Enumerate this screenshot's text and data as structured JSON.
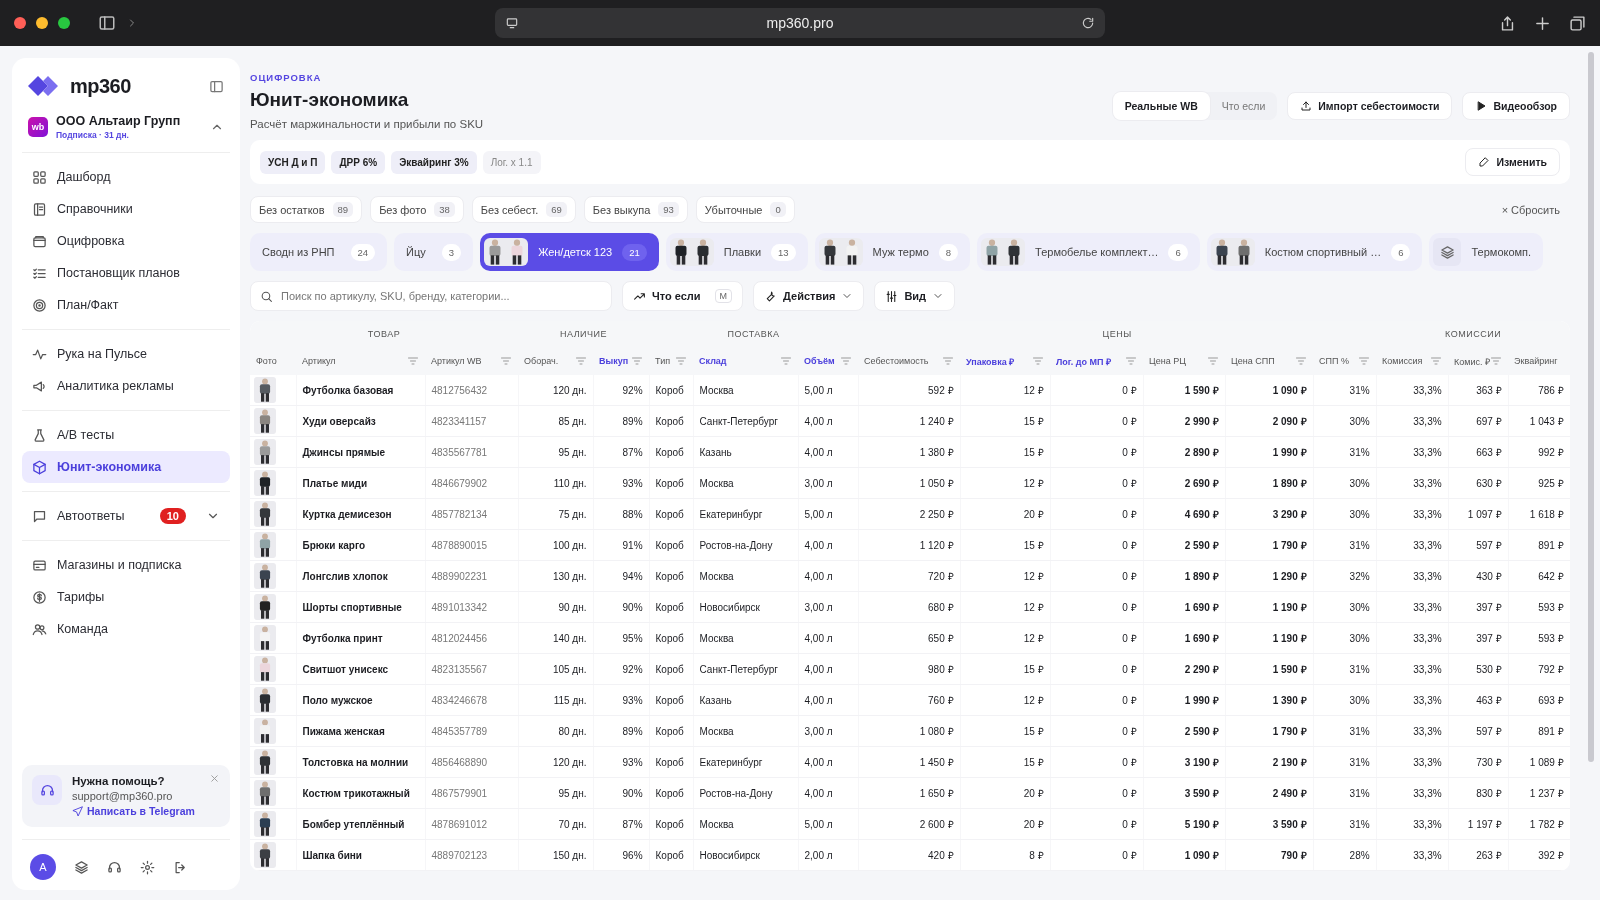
{
  "browser": {
    "url": "mp360.pro"
  },
  "sidebar": {
    "logo": "mp360",
    "account": {
      "badge": "wb",
      "name": "ООО Альтаир Групп",
      "subscription": "Подписка · 31 дн.",
      "expanded": true
    },
    "groups": [
      [
        {
          "label": "Дашборд",
          "selected": false
        },
        {
          "label": "Справочники",
          "selected": false
        },
        {
          "label": "Оцифровка",
          "selected": false
        },
        {
          "label": "Постановщик планов",
          "selected": false
        },
        {
          "label": "План/Факт",
          "selected": false
        }
      ],
      [
        {
          "label": "Рука на Пульсе",
          "selected": false
        },
        {
          "label": "Аналитика рекламы",
          "selected": false
        }
      ],
      [
        {
          "label": "A/B тесты",
          "selected": false
        },
        {
          "label": "Юнит-экономика",
          "selected": true
        }
      ],
      [
        {
          "label": "Автоответы",
          "selected": false,
          "badge": "10",
          "expanded": false
        }
      ],
      [
        {
          "label": "Магазины и подписка",
          "selected": false
        },
        {
          "label": "Тарифы",
          "selected": false
        },
        {
          "label": "Команда",
          "selected": false
        }
      ]
    ],
    "help": {
      "title": "Нужна помощь?",
      "email": "support@mp360.pro",
      "link": "Написать в Telegram"
    },
    "avatar": "A"
  },
  "header": {
    "breadcrumb": "ОЦИФРОВКА",
    "title": "Юнит-экономика",
    "subtitle": "Расчёт маржинальности и прибыли по SKU",
    "modes": [
      {
        "label": "Реальные WB",
        "selected": true
      },
      {
        "label": "Что если",
        "selected": false
      }
    ],
    "buttons": [
      {
        "label": "Импорт себестоимости",
        "kind": "upload"
      },
      {
        "label": "Видеообзор",
        "kind": "play"
      }
    ]
  },
  "settings": {
    "chips": [
      {
        "label": "УСН Д и П",
        "active": true
      },
      {
        "label": "ДРР 6%",
        "active": true
      },
      {
        "label": "Эквайринг 3%",
        "active": true
      },
      {
        "label": "Лог. x 1.1",
        "active": false
      }
    ],
    "edit_button": "Изменить"
  },
  "filters": [
    {
      "label": "Без остатков",
      "count": "89",
      "selected": false
    },
    {
      "label": "Без фото",
      "count": "38",
      "selected": false
    },
    {
      "label": "Без себест.",
      "count": "69",
      "selected": false
    },
    {
      "label": "Без выкупа",
      "count": "93",
      "selected": false
    },
    {
      "label": "Убыточные",
      "count": "0",
      "selected": false
    }
  ],
  "reset": "× Сбросить",
  "segments": [
    {
      "label": "Сводн из РНП",
      "count": "24",
      "selected": false,
      "kind": "plain"
    },
    {
      "label": "Йцу",
      "count": "3",
      "selected": false,
      "kind": "plain"
    },
    {
      "label": "Жен/детск 123",
      "count": "21",
      "selected": true,
      "kind": "thumb"
    },
    {
      "label": "Плавки",
      "count": "13",
      "selected": false,
      "kind": "thumb"
    },
    {
      "label": "Муж термо",
      "count": "8",
      "selected": false,
      "kind": "thumb"
    },
    {
      "label": "Термобелье комплект…",
      "count": "6",
      "selected": false,
      "kind": "thumb"
    },
    {
      "label": "Костюм спортивный …",
      "count": "6",
      "selected": false,
      "kind": "thumb"
    },
    {
      "label": "Термокомп.",
      "selected": false,
      "kind": "icon"
    }
  ],
  "toolbar": {
    "search": {
      "placeholder": "Поиск по артикулу, SKU, бренду, категории..."
    },
    "whatif": {
      "label": "Что если",
      "key": "M"
    },
    "actions": "Действия",
    "view": "Вид"
  },
  "table": {
    "column_groups": [
      {
        "label": "ТОВАР",
        "columns": [
          {
            "label": "Фото",
            "filter": false,
            "highlighted": false
          },
          {
            "label": "Артикул",
            "filter": true,
            "highlighted": false
          },
          {
            "label": "Артикул WB",
            "filter": true,
            "highlighted": false
          }
        ]
      },
      {
        "label": "НАЛИЧИЕ",
        "columns": [
          {
            "label": "Оборач.",
            "filter": true,
            "highlighted": false
          },
          {
            "label": "Выкуп",
            "filter": true,
            "highlighted": true
          }
        ]
      },
      {
        "label": "ПОСТАВКА",
        "columns": [
          {
            "label": "Тип",
            "filter": true,
            "highlighted": false
          },
          {
            "label": "Склад",
            "filter": true,
            "highlighted": true
          },
          {
            "label": "Объём",
            "filter": true,
            "highlighted": true
          }
        ]
      },
      {
        "label": "ЦЕНЫ",
        "columns": [
          {
            "label": "Себестоимость",
            "filter": true,
            "highlighted": false
          },
          {
            "label": "Упаковка ₽",
            "filter": true,
            "highlighted": true
          },
          {
            "label": "Лог. до МП ₽",
            "filter": true,
            "highlighted": true
          },
          {
            "label": "Цена РЦ",
            "filter": true,
            "highlighted": false
          },
          {
            "label": "Цена СПП",
            "filter": true,
            "highlighted": false
          },
          {
            "label": "СПП %",
            "filter": true,
            "highlighted": false
          }
        ]
      },
      {
        "label": "КОМИССИИ",
        "columns": [
          {
            "label": "Комиссия",
            "filter": true,
            "highlighted": false
          },
          {
            "label": "Комис. ₽",
            "filter": true,
            "highlighted": false
          },
          {
            "label": "Эквайринг",
            "filter": false,
            "highlighted": false
          }
        ]
      }
    ],
    "rows": [
      {
        "cells": [
          "Футболка базовая",
          "4812756432",
          "120 дн.",
          "92%",
          "Короб",
          "Москва",
          "5,00 л",
          "592 ₽",
          "12 ₽",
          "0 ₽",
          "1 590 ₽",
          "1 090 ₽",
          "31%",
          "33,3%",
          "363 ₽",
          "786 ₽"
        ]
      },
      {
        "cells": [
          "Худи оверсайз",
          "4823341157",
          "85 дн.",
          "89%",
          "Короб",
          "Санкт-Петербург",
          "4,00 л",
          "1 240 ₽",
          "15 ₽",
          "0 ₽",
          "2 990 ₽",
          "2 090 ₽",
          "30%",
          "33,3%",
          "697 ₽",
          "1 043 ₽"
        ]
      },
      {
        "cells": [
          "Джинсы прямые",
          "4835567781",
          "95 дн.",
          "87%",
          "Короб",
          "Казань",
          "4,00 л",
          "1 380 ₽",
          "15 ₽",
          "0 ₽",
          "2 890 ₽",
          "1 990 ₽",
          "31%",
          "33,3%",
          "663 ₽",
          "992 ₽"
        ]
      },
      {
        "cells": [
          "Платье миди",
          "4846679902",
          "110 дн.",
          "93%",
          "Короб",
          "Москва",
          "3,00 л",
          "1 050 ₽",
          "12 ₽",
          "0 ₽",
          "2 690 ₽",
          "1 890 ₽",
          "30%",
          "33,3%",
          "630 ₽",
          "925 ₽"
        ]
      },
      {
        "cells": [
          "Куртка демисезон",
          "4857782134",
          "75 дн.",
          "88%",
          "Короб",
          "Екатеринбург",
          "5,00 л",
          "2 250 ₽",
          "20 ₽",
          "0 ₽",
          "4 690 ₽",
          "3 290 ₽",
          "30%",
          "33,3%",
          "1 097 ₽",
          "1 618 ₽"
        ]
      },
      {
        "cells": [
          "Брюки карго",
          "4878890015",
          "100 дн.",
          "91%",
          "Короб",
          "Ростов-на-Дону",
          "4,00 л",
          "1 120 ₽",
          "15 ₽",
          "0 ₽",
          "2 590 ₽",
          "1 790 ₽",
          "31%",
          "33,3%",
          "597 ₽",
          "891 ₽"
        ]
      },
      {
        "cells": [
          "Лонгслив хлопок",
          "4889902231",
          "130 дн.",
          "94%",
          "Короб",
          "Москва",
          "4,00 л",
          "720 ₽",
          "12 ₽",
          "0 ₽",
          "1 890 ₽",
          "1 290 ₽",
          "32%",
          "33,3%",
          "430 ₽",
          "642 ₽"
        ]
      },
      {
        "cells": [
          "Шорты спортивные",
          "4891013342",
          "90 дн.",
          "90%",
          "Короб",
          "Новосибирск",
          "3,00 л",
          "680 ₽",
          "12 ₽",
          "0 ₽",
          "1 690 ₽",
          "1 190 ₽",
          "30%",
          "33,3%",
          "397 ₽",
          "593 ₽"
        ]
      },
      {
        "cells": [
          "Футболка принт",
          "4812024456",
          "140 дн.",
          "95%",
          "Короб",
          "Москва",
          "4,00 л",
          "650 ₽",
          "12 ₽",
          "0 ₽",
          "1 690 ₽",
          "1 190 ₽",
          "30%",
          "33,3%",
          "397 ₽",
          "593 ₽"
        ]
      },
      {
        "cells": [
          "Свитшот унисекс",
          "4823135567",
          "105 дн.",
          "92%",
          "Короб",
          "Санкт-Петербург",
          "4,00 л",
          "980 ₽",
          "15 ₽",
          "0 ₽",
          "2 290 ₽",
          "1 590 ₽",
          "31%",
          "33,3%",
          "530 ₽",
          "792 ₽"
        ]
      },
      {
        "cells": [
          "Поло мужское",
          "4834246678",
          "115 дн.",
          "93%",
          "Короб",
          "Казань",
          "4,00 л",
          "760 ₽",
          "12 ₽",
          "0 ₽",
          "1 990 ₽",
          "1 390 ₽",
          "30%",
          "33,3%",
          "463 ₽",
          "693 ₽"
        ]
      },
      {
        "cells": [
          "Пижама женская",
          "4845357789",
          "80 дн.",
          "89%",
          "Короб",
          "Москва",
          "3,00 л",
          "1 080 ₽",
          "15 ₽",
          "0 ₽",
          "2 590 ₽",
          "1 790 ₽",
          "31%",
          "33,3%",
          "597 ₽",
          "891 ₽"
        ]
      },
      {
        "cells": [
          "Толстовка на молнии",
          "4856468890",
          "120 дн.",
          "93%",
          "Короб",
          "Екатеринбург",
          "4,00 л",
          "1 450 ₽",
          "15 ₽",
          "0 ₽",
          "3 190 ₽",
          "2 190 ₽",
          "31%",
          "33,3%",
          "730 ₽",
          "1 089 ₽"
        ]
      },
      {
        "cells": [
          "Костюм трикотажный",
          "4867579901",
          "95 дн.",
          "90%",
          "Короб",
          "Ростов-на-Дону",
          "4,00 л",
          "1 650 ₽",
          "20 ₽",
          "0 ₽",
          "3 590 ₽",
          "2 490 ₽",
          "31%",
          "33,3%",
          "830 ₽",
          "1 237 ₽"
        ]
      },
      {
        "cells": [
          "Бомбер утеплённый",
          "4878691012",
          "70 дн.",
          "87%",
          "Короб",
          "Москва",
          "5,00 л",
          "2 600 ₽",
          "20 ₽",
          "0 ₽",
          "5 190 ₽",
          "3 590 ₽",
          "31%",
          "33,3%",
          "1 197 ₽",
          "1 782 ₽"
        ]
      },
      {
        "cells": [
          "Шапка бини",
          "4889702123",
          "150 дн.",
          "96%",
          "Короб",
          "Новосибирск",
          "2,00 л",
          "420 ₽",
          "8 ₽",
          "0 ₽",
          "1 090 ₽",
          "790 ₽",
          "28%",
          "33,3%",
          "263 ₽",
          "392 ₽"
        ]
      }
    ]
  }
}
